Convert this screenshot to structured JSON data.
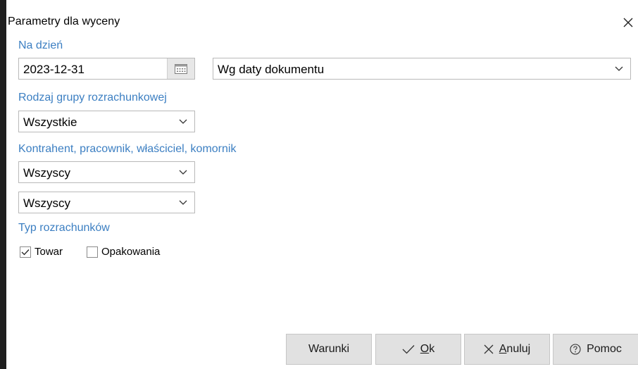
{
  "window": {
    "title": "Parametry dla wyceny"
  },
  "na_dzien": {
    "label": "Na dzień",
    "date_value": "2023-12-31",
    "date_mode": "Wg daty dokumentu"
  },
  "rodzaj_grupy": {
    "label": "Rodzaj grupy rozrachunkowej",
    "value": "Wszystkie"
  },
  "kontrahent": {
    "label": "Kontrahent, pracownik, właściciel, komornik",
    "select1": "Wszyscy",
    "select2": "Wszyscy"
  },
  "typ_rozrachunkow": {
    "label": "Typ rozrachunków",
    "options": [
      {
        "label": "Towar",
        "checked": true
      },
      {
        "label": "Opakowania",
        "checked": false
      }
    ]
  },
  "buttons": {
    "warunki": "Warunki",
    "ok_mnemonic": "O",
    "ok_rest": "k",
    "anuluj_mnemonic": "A",
    "anuluj_rest": "nuluj",
    "pomoc": "Pomoc"
  }
}
